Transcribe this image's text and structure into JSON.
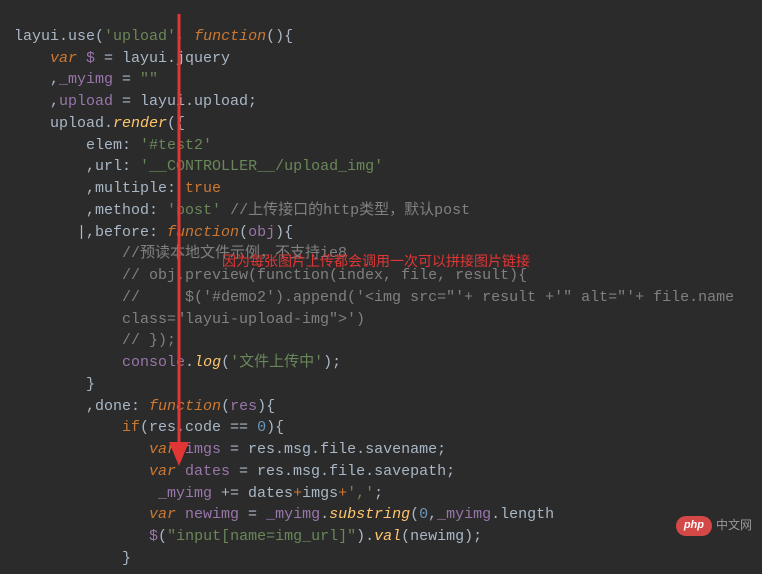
{
  "code": {
    "l1_a": "layui",
    "l1_b": ".use(",
    "l1_c": "'upload'",
    "l1_d": ", ",
    "l1_e": "function",
    "l1_f": "(){",
    "l2_a": "    var ",
    "l2_b": "$",
    "l2_c": " = layui.jquery",
    "l3_a": "    ,",
    "l3_b": "_myimg",
    "l3_c": " = ",
    "l3_d": "\"\"",
    "l4_a": "    ,",
    "l4_b": "upload",
    "l4_c": " = layui.upload;",
    "l5_a": "    upload.",
    "l5_b": "render",
    "l5_c": "({",
    "l6_a": "        elem",
    "l6_b": ": ",
    "l6_c": "'#test2'",
    "l7_a": "        ,url",
    "l7_b": ": ",
    "l7_c": "'__CONTROLLER__/upload_img'",
    "l8_a": "        ,multiple",
    "l8_b": ": ",
    "l8_c": "true",
    "l9_a": "        ,method",
    "l9_b": ": ",
    "l9_c": "'post' ",
    "l9_d": "//上传接口的http类型，默认post",
    "l10_a": "       |,before",
    "l10_b": ": ",
    "l10_c": "function",
    "l10_d": "(",
    "l10_e": "obj",
    "l10_f": "){",
    "l11": "            //预读本地文件示例，不支持ie8",
    "l12": "            // obj.preview(function(index, file, result){",
    "l13": "            //     $('#demo2').append('<img src=\"'+ result +'\" alt=\"'+ file.name ",
    "l14": "            class=\"layui-upload-img\">')",
    "l15": "            // });",
    "l16_a": "            ",
    "l16_b": "console",
    "l16_c": ".",
    "l16_d": "log",
    "l16_e": "(",
    "l16_f": "'文件上传中'",
    "l16_g": ");",
    "l17": "        }",
    "l18_a": "        ,done",
    "l18_b": ": ",
    "l18_c": "function",
    "l18_d": "(",
    "l18_e": "res",
    "l18_f": "){",
    "l19_a": "            if",
    "l19_b": "(res.code == ",
    "l19_c": "0",
    "l19_d": "){",
    "l20_a": "               var ",
    "l20_b": "imgs",
    "l20_c": " = res.msg.file.savename;",
    "l21_a": "               var ",
    "l21_b": "dates",
    "l21_c": " = res.msg.file.savepath;",
    "l22_a": "                ",
    "l22_b": "_myimg",
    "l22_c": " += dates",
    "l22_d": "+",
    "l22_e": "imgs",
    "l22_f": "+",
    "l22_g": "','",
    "l22_h": ";",
    "l23_a": "               var ",
    "l23_b": "newimg",
    "l23_c": " = ",
    "l23_d": "_myimg",
    "l23_e": ".",
    "l23_f": "substring",
    "l23_g": "(",
    "l23_h": "0",
    "l23_i": ",",
    "l23_j": "_myimg",
    "l23_k": ".length",
    "l24_a": "               ",
    "l24_b": "$",
    "l24_c": "(",
    "l24_d": "\"input[name=img_url]\"",
    "l24_e": ").",
    "l24_f": "val",
    "l24_g": "(newimg);",
    "l25": "            }"
  },
  "annotation": "因为每张图片上传都会调用一次可以拼接图片链接",
  "watermark": {
    "badge": "php",
    "text": "中文网"
  }
}
